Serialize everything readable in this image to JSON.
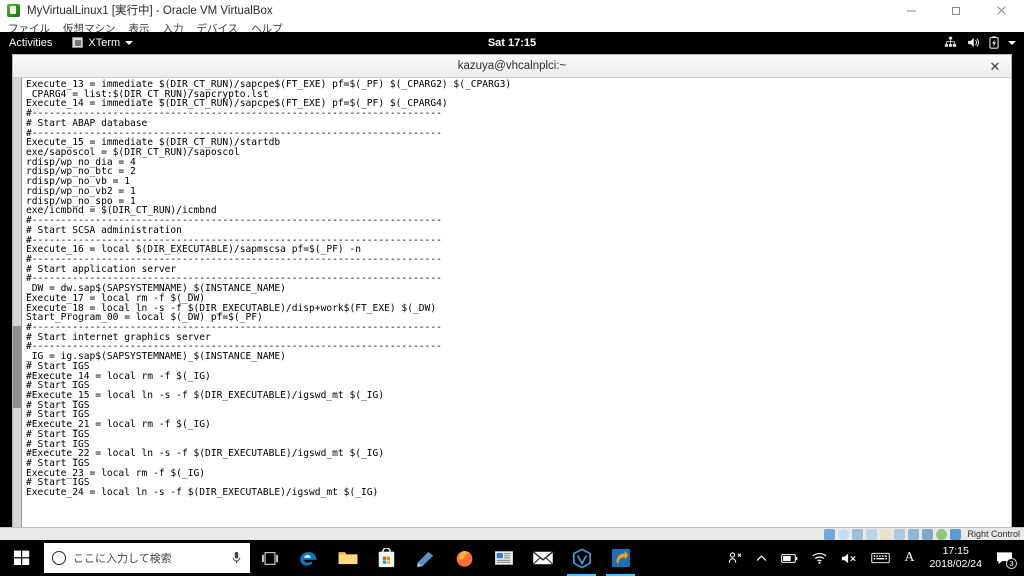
{
  "vbox": {
    "title": "MyVirtualLinux1 [実行中] - Oracle VM VirtualBox",
    "app_icon": "virtualbox-icon",
    "menu": [
      {
        "label": "ファイル"
      },
      {
        "label": "仮想マシン"
      },
      {
        "label": "表示"
      },
      {
        "label": "入力"
      },
      {
        "label": "デバイス"
      },
      {
        "label": "ヘルプ"
      }
    ],
    "window_controls": {
      "minimize": "—",
      "restore": "❐",
      "close": "✕"
    },
    "statusbar": {
      "host_key_label": "Right Control",
      "icons": [
        "hard-disk-icon",
        "optical-disk-icon",
        "network-icon",
        "usb-icon",
        "shared-folder-icon",
        "display-icon",
        "video-capture-icon",
        "mouse-integration-icon",
        "guest-additions-icon",
        "host-key-icon"
      ]
    }
  },
  "gnome": {
    "activities_label": "Activities",
    "app_menu_label": "XTerm",
    "app_menu_icon": "xterm-icon",
    "clock": "Sat 17:15",
    "status_icons": [
      "network-wired-icon",
      "volume-icon",
      "battery-icon",
      "chevron-down-icon"
    ]
  },
  "terminal": {
    "title": "kazuya@vhcalnplci:~",
    "close_label": "✕",
    "content": "Execute_13 = immediate $(DIR_CT_RUN)/sapcpe$(FT_EXE) pf=$(_PF) $(_CPARG2) $(_CPARG3)\n_CPARG4 = list:$(DIR_CT_RUN)/sapcrypto.lst\nExecute_14 = immediate $(DIR_CT_RUN)/sapcpe$(FT_EXE) pf=$(_PF) $(_CPARG4)\n#-----------------------------------------------------------------------\n# Start ABAP database\n#-----------------------------------------------------------------------\nExecute_15 = immediate $(DIR_CT_RUN)/startdb\nexe/saposcol = $(DIR_CT_RUN)/saposcol\nrdisp/wp_no_dia = 4\nrdisp/wp_no_btc = 2\nrdisp/wp_no_vb = 1\nrdisp/wp_no_vb2 = 1\nrdisp/wp_no_spo = 1\nexe/icmbnd = $(DIR_CT_RUN)/icmbnd\n#-----------------------------------------------------------------------\n# Start SCSA administration\n#-----------------------------------------------------------------------\nExecute_16 = local $(DIR_EXECUTABLE)/sapmscsa pf=$(_PF) -n\n#-----------------------------------------------------------------------\n# Start application server\n#-----------------------------------------------------------------------\n_DW = dw.sap$(SAPSYSTEMNAME)_$(INSTANCE_NAME)\nExecute_17 = local rm -f $(_DW)\nExecute_18 = local ln -s -f $(DIR_EXECUTABLE)/disp+work$(FT_EXE) $(_DW)\nStart_Program_00 = local $(_DW) pf=$(_PF)\n#-----------------------------------------------------------------------\n# Start internet graphics server\n#-----------------------------------------------------------------------\n_IG = ig.sap$(SAPSYSTEMNAME)_$(INSTANCE_NAME)\n# Start IGS\n#Execute_14 = local rm -f $(_IG)\n# Start IGS\n#Execute_15 = local ln -s -f $(DIR_EXECUTABLE)/igswd_mt $(_IG)\n# Start IGS\n# Start IGS\n#Execute_21 = local rm -f $(_IG)\n# Start IGS\n# Start IGS\n#Execute_22 = local ln -s -f $(DIR_EXECUTABLE)/igswd_mt $(_IG)\n# Start IGS\nExecute_23 = local rm -f $(_IG)\n# Start IGS\nExecute_24 = local ln -s -f $(DIR_EXECUTABLE)/igswd_mt $(_IG)"
  },
  "taskbar": {
    "start_label": "start-button",
    "search_placeholder": "ここに入力して検索",
    "microphone_icon": "microphone-icon",
    "cortana_icon": "cortana-circle-icon",
    "apps": [
      {
        "name": "task-view-icon"
      },
      {
        "name": "edge-icon"
      },
      {
        "name": "file-explorer-icon"
      },
      {
        "name": "microsoft-store-icon"
      },
      {
        "name": "sticky-notes-icon"
      },
      {
        "name": "firefox-icon"
      },
      {
        "name": "news-icon"
      },
      {
        "name": "mail-icon"
      },
      {
        "name": "virtualbox-icon"
      },
      {
        "name": "app-orange-icon"
      }
    ],
    "systray": {
      "icons": [
        "people-icon",
        "show-hidden-icons-chevron",
        "battery-icon",
        "wifi-icon",
        "speaker-muted-icon",
        "keyboard-ime-icon",
        "ime-mode-a"
      ],
      "ime_letter": "A",
      "time": "17:15",
      "date": "2018/02/24",
      "notification_count": "3"
    }
  },
  "colors": {
    "accent": "#4cc2ff",
    "taskbar_bg": "#000000",
    "terminal_bg": "#ffffff",
    "terminal_fg": "#000000"
  }
}
